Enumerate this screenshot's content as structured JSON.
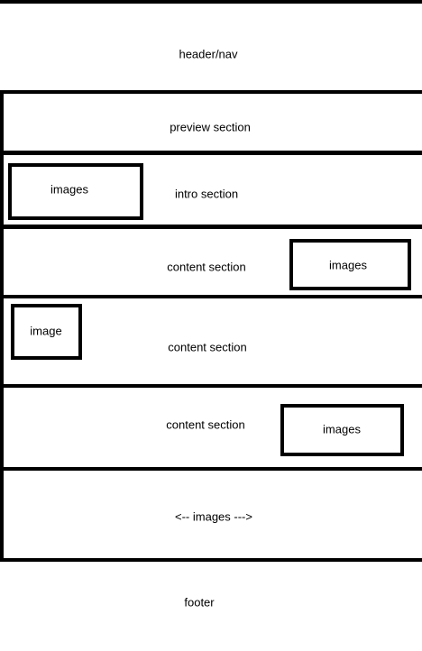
{
  "header": {
    "label": "header/nav"
  },
  "preview": {
    "label": "preview section"
  },
  "intro": {
    "label": "intro section",
    "box_label": "images"
  },
  "content1": {
    "label": "content section",
    "box_label": "images"
  },
  "content2": {
    "label": "content section",
    "box_label": "image"
  },
  "content3": {
    "label": "content section",
    "box_label": "images"
  },
  "gallery": {
    "label": "<-- images --->"
  },
  "footer": {
    "label": "footer"
  }
}
